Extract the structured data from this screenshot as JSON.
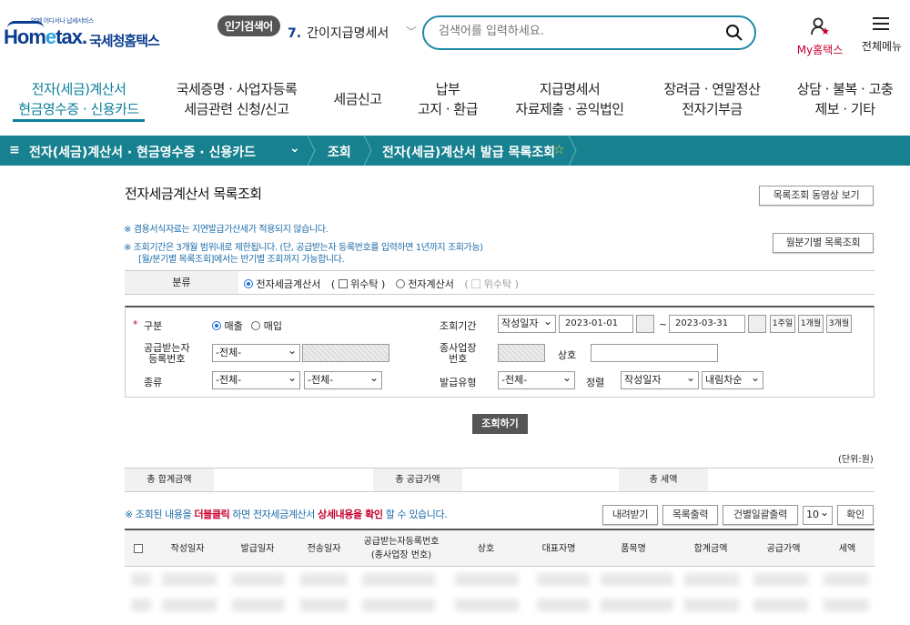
{
  "header": {
    "logo_tagline": "언제 어디서나 납세서비스",
    "logo_brand_a": "Hom",
    "logo_brand_e": "e",
    "logo_brand_b": "tax.",
    "logo_korean": "국세청홈택스",
    "popular_label": "인기검색어",
    "popular_rank": "7.",
    "popular_term": "간이지급명세서",
    "search_placeholder": "검색어를 입력하세요.",
    "my_label": "My홈택스",
    "menu_label": "전체메뉴"
  },
  "nav": [
    {
      "l1": "전자(세금)계산서",
      "l2": "현금영수증 · 신용카드"
    },
    {
      "l1": "국세증명 · 사업자등록",
      "l2": "세금관련 신청/신고"
    },
    {
      "l1": "세금신고",
      "l2": ""
    },
    {
      "l1": "납부",
      "l2": "고지 · 환급"
    },
    {
      "l1": "지급명세서",
      "l2": "자료제출 · 공익법인"
    },
    {
      "l1": "장려금 · 연말정산",
      "l2": "전자기부금"
    },
    {
      "l1": "상담 · 불복 · 고충",
      "l2": "제보 · 기타"
    }
  ],
  "breadcrumb": {
    "menu_glyph": "≡",
    "section": "전자(세금)계산서 · 현금영수증 · 신용카드",
    "level2": "조회",
    "level3": "전자(세금)계산서 발급 목록조회",
    "star": "☆"
  },
  "page": {
    "title": "전자세금계산서 목록조회",
    "video_button": "목록조회 동영상 보기",
    "note1": "※ 겸용서식자료는 지연발급가산세가 적용되지 않습니다.",
    "note2": "※ 조회기간은 3개월 범위내로 제한됩니다. (단, 공급받는자 등록번호를 입력하면 1년까지 조회가능)",
    "note3": "[월/분기별 목록조회]에서는 반기별 조회까지 가능합니다.",
    "monthly_button": "월분기별 목록조회"
  },
  "classification": {
    "label": "분류",
    "opt1": "전자세금계산서",
    "paren_open": "(",
    "paren_close": ")",
    "consign": "위수탁",
    "opt2": "전자계산서",
    "consign2": "위수탁"
  },
  "form": {
    "req_mark": "*",
    "gubun_label": "구분",
    "sale": "매출",
    "purchase": "매입",
    "period_label": "조회기간",
    "period_type": "작성일자",
    "date_from": "2023-01-01",
    "tilde": "~",
    "date_to": "2023-03-31",
    "btn_1week": "1주일",
    "btn_1month": "1개월",
    "btn_3month": "3개월",
    "buyer_label_1": "공급받는자",
    "buyer_label_2": "등록번호",
    "buyer_select": "-전체-",
    "branch_label_1": "종사업장",
    "branch_label_2": "번호",
    "company_label": "상호",
    "kind_label": "종류",
    "kind_select1": "-전체-",
    "kind_select2": "-전체-",
    "issue_type_label": "발급유형",
    "issue_type_select": "-전체-",
    "sort_label": "정렬",
    "sort_field": "작성일자",
    "sort_order": "내림차순"
  },
  "query_button": "조회하기",
  "unit_label": "(단위:원)",
  "totals": {
    "total_amount": "총 합계금액",
    "supply_amount": "총 공급가액",
    "tax_amount": "총 세액"
  },
  "message": {
    "p1": "※ 조회된 내용을 ",
    "p2": "더블클릭",
    "p3": " 하면 전자세금계산서 ",
    "p4": "상세내용을 확인",
    "p5": " 할 수 있습니다."
  },
  "actions": {
    "download": "내려받기",
    "print_list": "목록출력",
    "batch_print": "건별일괄출력",
    "page_size": "10",
    "confirm": "확인"
  },
  "table_headers": [
    "작성일자",
    "발급일자",
    "전송일자",
    "공급받는자등록번호\n(종사업장 번호)",
    "상호",
    "대표자명",
    "품목명",
    "합계금액",
    "공급가액",
    "세액"
  ],
  "colors": {
    "accent": "#17818f",
    "brand": "#0a3d8f",
    "alert": "#c8002f",
    "note": "#1d6ca8"
  }
}
